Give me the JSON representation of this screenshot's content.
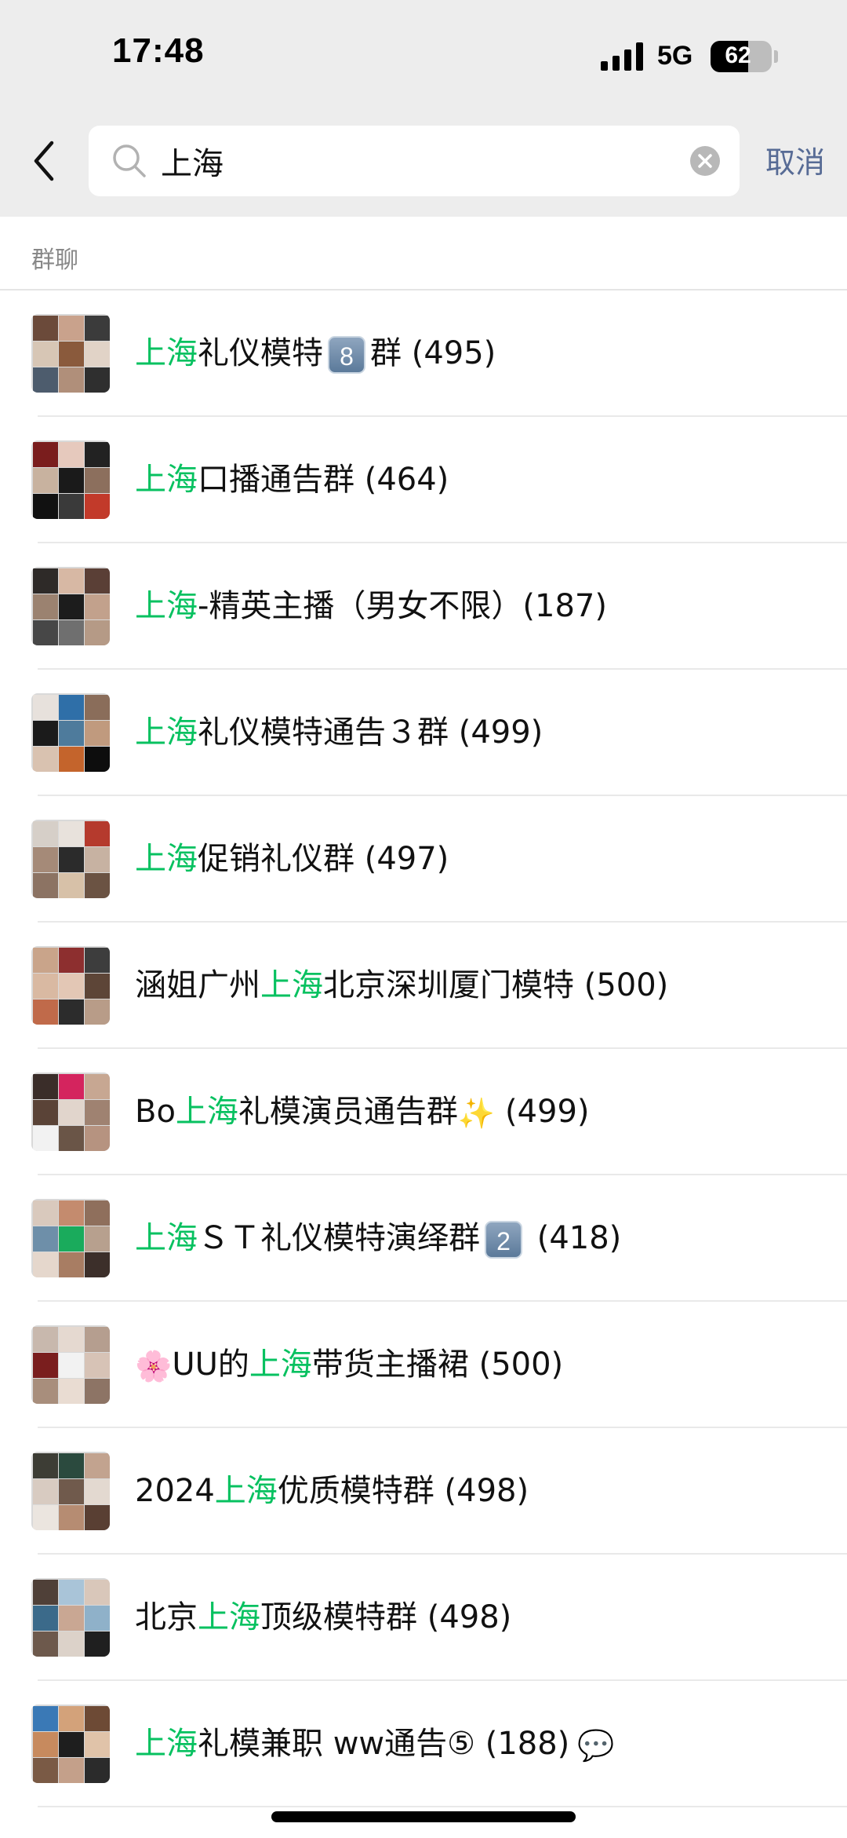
{
  "status_bar": {
    "time": "17:48",
    "network": "5G",
    "battery_percent": 62,
    "battery_label": "62"
  },
  "search": {
    "query": "上海",
    "cancel_label": "取消"
  },
  "section": {
    "title": "群聊"
  },
  "colors": {
    "highlight": "#07c160",
    "link": "#576b95",
    "header_bg": "#ededed"
  },
  "results": [
    {
      "pre": "",
      "hl": "上海",
      "post": "礼仪模特",
      "badge": "8",
      "post2": "群 (495)"
    },
    {
      "pre": "",
      "hl": "上海",
      "post": "口播通告群 (464)"
    },
    {
      "pre": "",
      "hl": "上海",
      "post": "-精英主播（男女不限）(187)"
    },
    {
      "pre": "",
      "hl": "上海",
      "post": "礼仪模特通告３群 (499)"
    },
    {
      "pre": "",
      "hl": "上海",
      "post": "促销礼仪群 (497)"
    },
    {
      "pre": "涵姐广州",
      "hl": "上海",
      "post": "北京深圳厦门模特 (500)"
    },
    {
      "pre": "Bo",
      "hl": "上海",
      "post": "礼模演员通告群",
      "emoji": "✨",
      "post2": " (499)"
    },
    {
      "pre": "",
      "hl": "上海",
      "post": "ＳＴ礼仪模特演绎群",
      "badge": "2",
      "post2": " (418)"
    },
    {
      "pre_emoji": "🌸",
      "pre": "UU的",
      "hl": "上海",
      "post": "带货主播裙 (500)"
    },
    {
      "pre": "2024",
      "hl": "上海",
      "post": "优质模特群 (498)"
    },
    {
      "pre": "北京",
      "hl": "上海",
      "post": "顶级模特群 (498)"
    },
    {
      "pre": "",
      "hl": "上海",
      "post": "礼模兼职 ww通告⑤ (188)",
      "emoji": "💬"
    }
  ]
}
